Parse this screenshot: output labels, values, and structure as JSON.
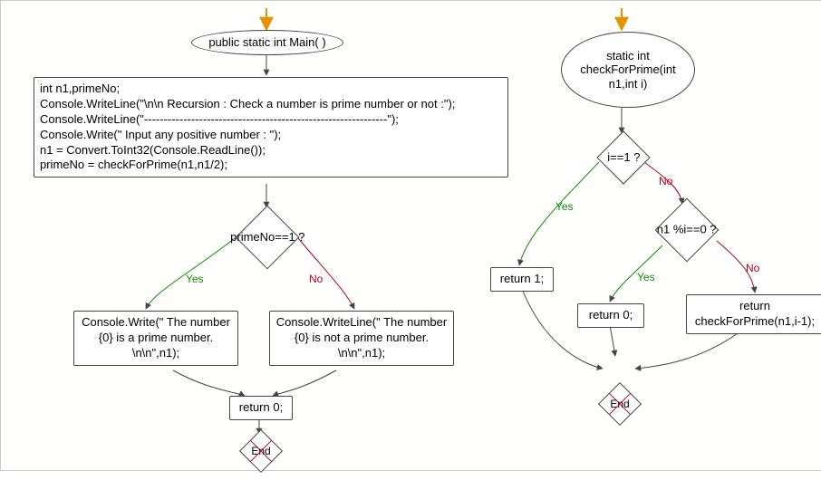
{
  "chart_data": [
    {
      "type": "flowchart",
      "title": "Main function",
      "nodes": [
        {
          "id": "main_start",
          "shape": "ellipse",
          "text": "public static int Main( )"
        },
        {
          "id": "main_block",
          "shape": "box",
          "text": "int n1,primeNo;\nConsole.WriteLine(\"\\n\\n Recursion : Check a number is prime number or not :\");\nConsole.WriteLine(\"--------------------------------------------------------------\");\nConsole.Write(\" Input any positive number : \");\nn1 = Convert.ToInt32(Console.ReadLine());\nprimeNo = checkForPrime(n1,n1/2);"
        },
        {
          "id": "main_dec",
          "shape": "diamond",
          "text": "primeNo==1 ?"
        },
        {
          "id": "main_yes",
          "shape": "box",
          "text": "Console.Write(\" The number {0} is a prime number. \\n\\n\",n1);"
        },
        {
          "id": "main_no",
          "shape": "box",
          "text": "Console.WriteLine(\" The number {0} is not a prime number. \\n\\n\",n1);"
        },
        {
          "id": "main_ret",
          "shape": "box",
          "text": "return 0;"
        },
        {
          "id": "main_end",
          "shape": "end",
          "text": "End"
        }
      ],
      "edges": [
        {
          "from": "entry",
          "to": "main_start",
          "label": ""
        },
        {
          "from": "main_start",
          "to": "main_block",
          "label": ""
        },
        {
          "from": "main_block",
          "to": "main_dec",
          "label": ""
        },
        {
          "from": "main_dec",
          "to": "main_yes",
          "label": "Yes"
        },
        {
          "from": "main_dec",
          "to": "main_no",
          "label": "No"
        },
        {
          "from": "main_yes",
          "to": "main_ret",
          "label": ""
        },
        {
          "from": "main_no",
          "to": "main_ret",
          "label": ""
        },
        {
          "from": "main_ret",
          "to": "main_end",
          "label": ""
        }
      ]
    },
    {
      "type": "flowchart",
      "title": "checkForPrime function",
      "nodes": [
        {
          "id": "cfp_start",
          "shape": "ellipse",
          "text": "static int checkForPrime(int n1,int i)"
        },
        {
          "id": "cfp_dec1",
          "shape": "diamond",
          "text": "i==1 ?"
        },
        {
          "id": "cfp_ret1",
          "shape": "box",
          "text": "return 1;"
        },
        {
          "id": "cfp_dec2",
          "shape": "diamond",
          "text": "n1 %i==0 ?"
        },
        {
          "id": "cfp_ret0",
          "shape": "box",
          "text": "return 0;"
        },
        {
          "id": "cfp_rec",
          "shape": "box",
          "text": "return checkForPrime(n1,i-1);"
        },
        {
          "id": "cfp_end",
          "shape": "end",
          "text": "End"
        }
      ],
      "edges": [
        {
          "from": "entry",
          "to": "cfp_start",
          "label": ""
        },
        {
          "from": "cfp_start",
          "to": "cfp_dec1",
          "label": ""
        },
        {
          "from": "cfp_dec1",
          "to": "cfp_ret1",
          "label": "Yes"
        },
        {
          "from": "cfp_dec1",
          "to": "cfp_dec2",
          "label": "No"
        },
        {
          "from": "cfp_dec2",
          "to": "cfp_ret0",
          "label": "Yes"
        },
        {
          "from": "cfp_dec2",
          "to": "cfp_rec",
          "label": "No"
        },
        {
          "from": "cfp_ret1",
          "to": "cfp_end",
          "label": ""
        },
        {
          "from": "cfp_ret0",
          "to": "cfp_end",
          "label": ""
        },
        {
          "from": "cfp_rec",
          "to": "cfp_end",
          "label": ""
        }
      ]
    }
  ],
  "left": {
    "start": "public static int Main( )",
    "block_l1": "int n1,primeNo;",
    "block_l2": "Console.WriteLine(\"\\n\\n Recursion : Check a number is prime number or not :\");",
    "block_l3": "Console.WriteLine(\"--------------------------------------------------------------\");",
    "block_l4": "Console.Write(\" Input any positive number : \");",
    "block_l5": "n1 = Convert.ToInt32(Console.ReadLine());",
    "block_l6": "primeNo = checkForPrime(n1,n1/2);",
    "dec": "primeNo==1 ?",
    "yesbox": "Console.Write(\" The number {0} is a prime number. \\n\\n\",n1);",
    "nobox": "Console.WriteLine(\" The number {0} is not a prime number. \\n\\n\",n1);",
    "ret": "return 0;",
    "end": "End"
  },
  "right": {
    "start": "static int checkForPrime(int n1,int i)",
    "dec1": "i==1 ?",
    "ret1": "return 1;",
    "dec2": "n1 %i==0 ?",
    "ret0": "return 0;",
    "rec": "return checkForPrime(n1,i-1);",
    "end": "End"
  },
  "labels": {
    "yes": "Yes",
    "no": "No"
  }
}
